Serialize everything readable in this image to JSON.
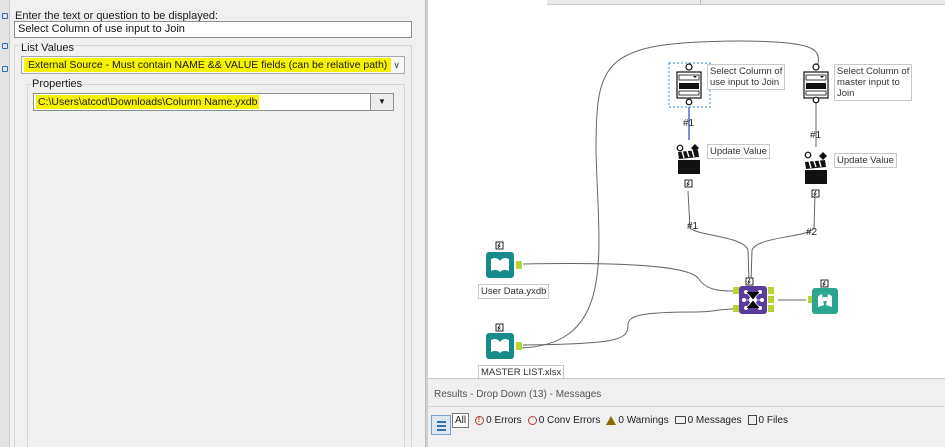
{
  "config": {
    "prompt_label": "Enter the text or question to be displayed:",
    "prompt_value": "Select Column of use input to Join",
    "list_values_title": "List Values",
    "source_selected": "External Source - Must contain NAME && VALUE fields  (can be relative path)",
    "properties_title": "Properties",
    "path_value": "C:\\Users\\atcod\\Downloads\\Column Name.yxdb",
    "path_button_icon": "chevron-down-icon",
    "source_chevron_icon": "chevron-down-icon"
  },
  "canvas": {
    "tools": {
      "dropdown_user": {
        "label": "Select Column of\nuse input to Join",
        "icon": "dropdown-icon"
      },
      "dropdown_master": {
        "label": "Select Column of\nmaster input to\nJoin",
        "icon": "dropdown-icon"
      },
      "action_user": {
        "label": "Update Value",
        "icon": "clapperboard-icon"
      },
      "action_master": {
        "label": "Update Value",
        "icon": "clapperboard-icon"
      },
      "input_user": {
        "label": "User Data.yxdb",
        "icon": "book-icon"
      },
      "input_master": {
        "label": "MASTER LIST.xlsx",
        "icon": "book-icon"
      },
      "join": {
        "icon": "join-icon",
        "anchors": [
          "L",
          "R",
          "J",
          "L",
          "R"
        ]
      },
      "browse": {
        "icon": "binoculars-icon"
      }
    },
    "link_labels": {
      "user_q": "#1",
      "master_q": "#1",
      "user_action": "#1",
      "master_action": "#2"
    },
    "colors": {
      "input_tool": "#178a8a",
      "join_tool": "#5a3d9a",
      "browse_tool": "#2aa68f",
      "selection": "#3a8fd0",
      "highlight": "#f6f200"
    }
  },
  "results": {
    "title": "Results - Drop Down (13) - Messages",
    "all_label": "All",
    "errors": "0 Errors",
    "conv_errors": "0 Conv Errors",
    "warnings": "0 Warnings",
    "messages": "0 Messages",
    "files": "0 Files"
  }
}
